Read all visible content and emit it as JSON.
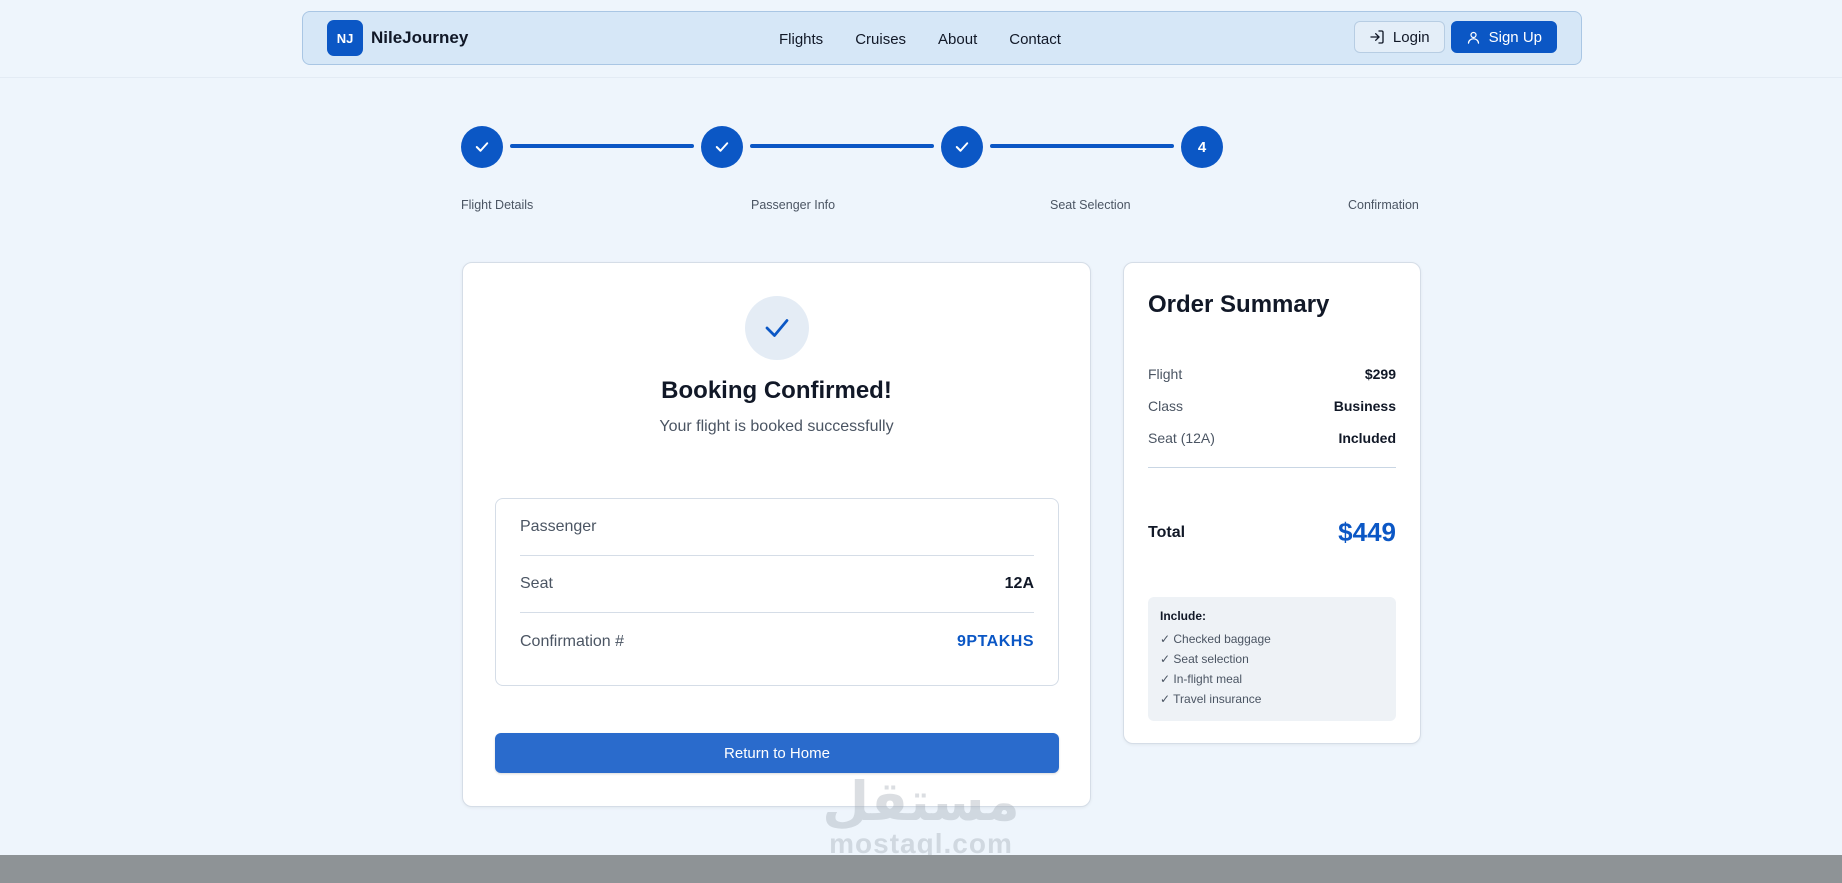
{
  "navbar": {
    "brand_initials": "NJ",
    "brand_name": "NileJourney",
    "links": [
      "Flights",
      "Cruises",
      "About",
      "Contact"
    ],
    "login_label": "Login",
    "signup_label": "Sign Up"
  },
  "stepper": {
    "steps": [
      {
        "label": "Flight Details",
        "state": "complete"
      },
      {
        "label": "Passenger Info",
        "state": "complete"
      },
      {
        "label": "Seat Selection",
        "state": "complete"
      },
      {
        "label": "Confirmation",
        "state": "current",
        "number": "4"
      }
    ]
  },
  "confirmation": {
    "title": "Booking Confirmed!",
    "subtitle": "Your flight is booked successfully",
    "details": [
      {
        "label": "Passenger",
        "value": ""
      },
      {
        "label": "Seat",
        "value": "12A"
      },
      {
        "label": "Confirmation #",
        "value": "9PTAKHS"
      }
    ],
    "return_button": "Return to Home"
  },
  "summary": {
    "title": "Order Summary",
    "rows": [
      {
        "label": "Flight",
        "value": "$299"
      },
      {
        "label": "Class",
        "value": "Business"
      },
      {
        "label": "Seat (12A)",
        "value": "Included"
      }
    ],
    "total_label": "Total",
    "total_value": "$449",
    "include_title": "Include:",
    "include_items": [
      "✓ Checked baggage",
      "✓ Seat selection",
      "✓ In-flight meal",
      "✓ Travel insurance"
    ]
  },
  "watermark": {
    "arabic": "مستقل",
    "latin": "mostaql.com"
  },
  "colors": {
    "primary": "#0b57c5",
    "button": "#2a6bcc",
    "background": "#eef5fc",
    "navbar": "#d6e7f7"
  }
}
